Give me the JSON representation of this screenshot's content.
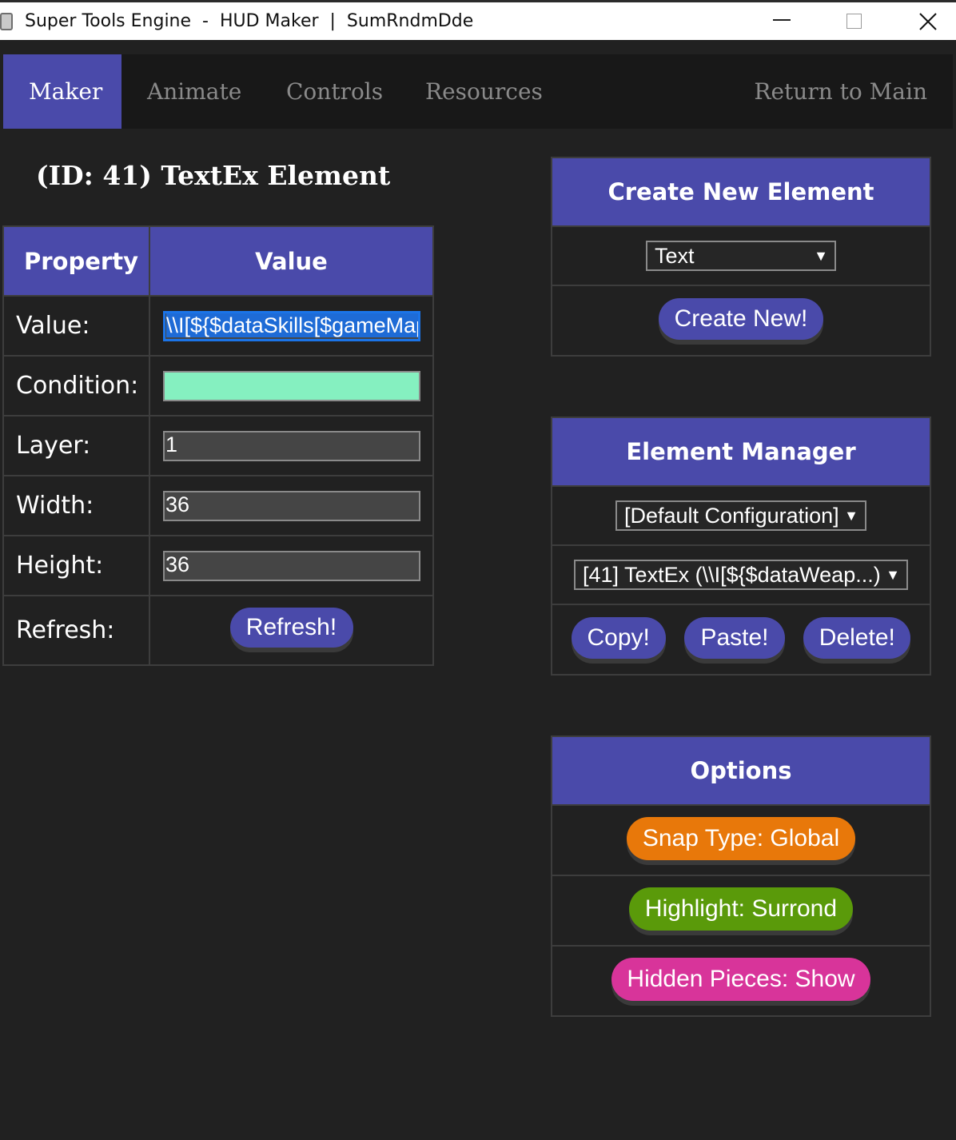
{
  "window": {
    "title": "Super Tools Engine  -  HUD Maker  |  SumRndmDde"
  },
  "nav": {
    "tabs": [
      "Maker",
      "Animate",
      "Controls",
      "Resources"
    ],
    "active": "Maker",
    "return_label": "Return to Main"
  },
  "element": {
    "title": "(ID: 41) TextEx Element"
  },
  "table": {
    "header_property": "Property",
    "header_value": "Value",
    "rows": {
      "value": {
        "label": "Value:",
        "value": "\\\\I[${$dataSkills[$gameMap"
      },
      "condition": {
        "label": "Condition:",
        "value": ""
      },
      "layer": {
        "label": "Layer:",
        "value": "1"
      },
      "width": {
        "label": "Width:",
        "value": "36"
      },
      "height": {
        "label": "Height:",
        "value": "36"
      },
      "refresh": {
        "label": "Refresh:",
        "button": "Refresh!"
      }
    }
  },
  "create_panel": {
    "title": "Create New Element",
    "type_selected": "Text",
    "create_button": "Create New!"
  },
  "manager_panel": {
    "title": "Element Manager",
    "config_selected": "[Default Configuration]",
    "element_selected": "[41] TextEx (\\\\I[${$dataWeap...)",
    "copy_button": "Copy!",
    "paste_button": "Paste!",
    "delete_button": "Delete!"
  },
  "options_panel": {
    "title": "Options",
    "snap_button": "Snap Type: Global",
    "highlight_button": "Highlight: Surrond",
    "hidden_button": "Hidden Pieces: Show"
  },
  "colors": {
    "accent": "#4a4aaa",
    "snap": "#e8780a",
    "highlight": "#5a9a0a",
    "hidden": "#d8349a",
    "condition_field": "#85f0c0"
  }
}
